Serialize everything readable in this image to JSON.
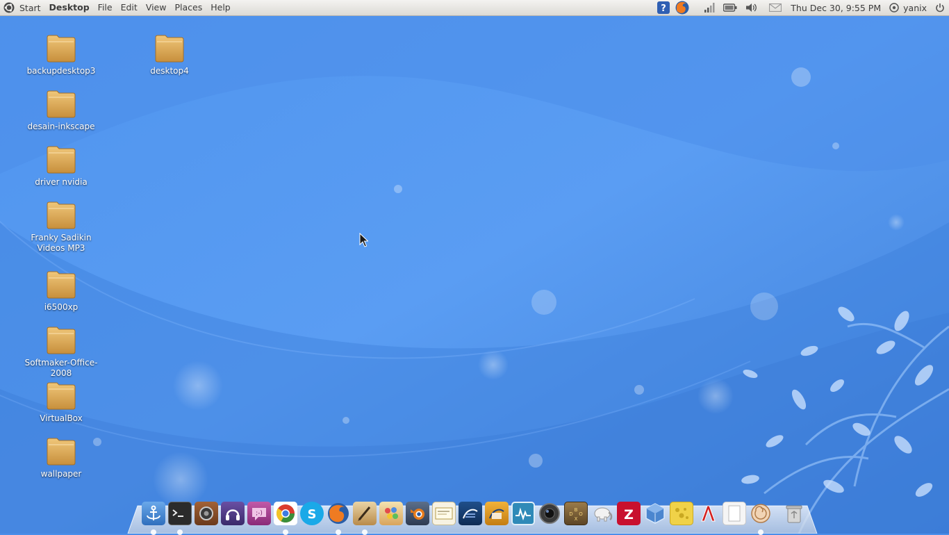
{
  "menubar": {
    "start_label": "Start",
    "menus": [
      "Desktop",
      "File",
      "Edit",
      "View",
      "Places",
      "Help"
    ]
  },
  "tray": {
    "icons": [
      "help-icon",
      "firefox-icon",
      "signal-icon",
      "battery-icon",
      "volume-icon",
      "mail-icon"
    ],
    "clock": "Thu Dec 30,  9:55 PM",
    "username": "yanix"
  },
  "desktop": {
    "icons": [
      "backupdesktop3",
      "desain-inkscape",
      "driver nvidia",
      "Franky Sadikin Videos MP3",
      "i6500xp",
      "Softmaker-Office-2008",
      "VirtualBox",
      "wallpaper",
      "desktop4"
    ]
  },
  "dock": {
    "items": [
      "anchor-icon",
      "terminal-icon",
      "speaker-icon",
      "headphones-icon",
      "pidgin-icon",
      "chrome-icon",
      "skype-icon",
      "firefox-icon",
      "inkscape-pen-icon",
      "mypaint-icon",
      "blender-icon",
      "easytag-icon",
      "writer-icon",
      "impress-icon",
      "system-monitor-icon",
      "camera-lens-icon",
      "dosbox-icon",
      "elephant-icon",
      "filezilla-icon",
      "virtualbox-cube-icon",
      "cheese-icon",
      "acrobat-icon",
      "document-icon",
      "shell-icon",
      "trash-icon"
    ],
    "colors": {
      "terminal": "#2b2b2b",
      "chrome": "#3a8f3a",
      "skype": "#1aa9e8",
      "filezilla": "#c8102e",
      "blender": "#e77b1b",
      "cheese": "#f0d248"
    }
  },
  "colors": {
    "wallpaper_base": "#4a8eea",
    "wallpaper_light": "#5ea2f5",
    "panel": "#e8e6e2",
    "folder": "#d9a954"
  }
}
